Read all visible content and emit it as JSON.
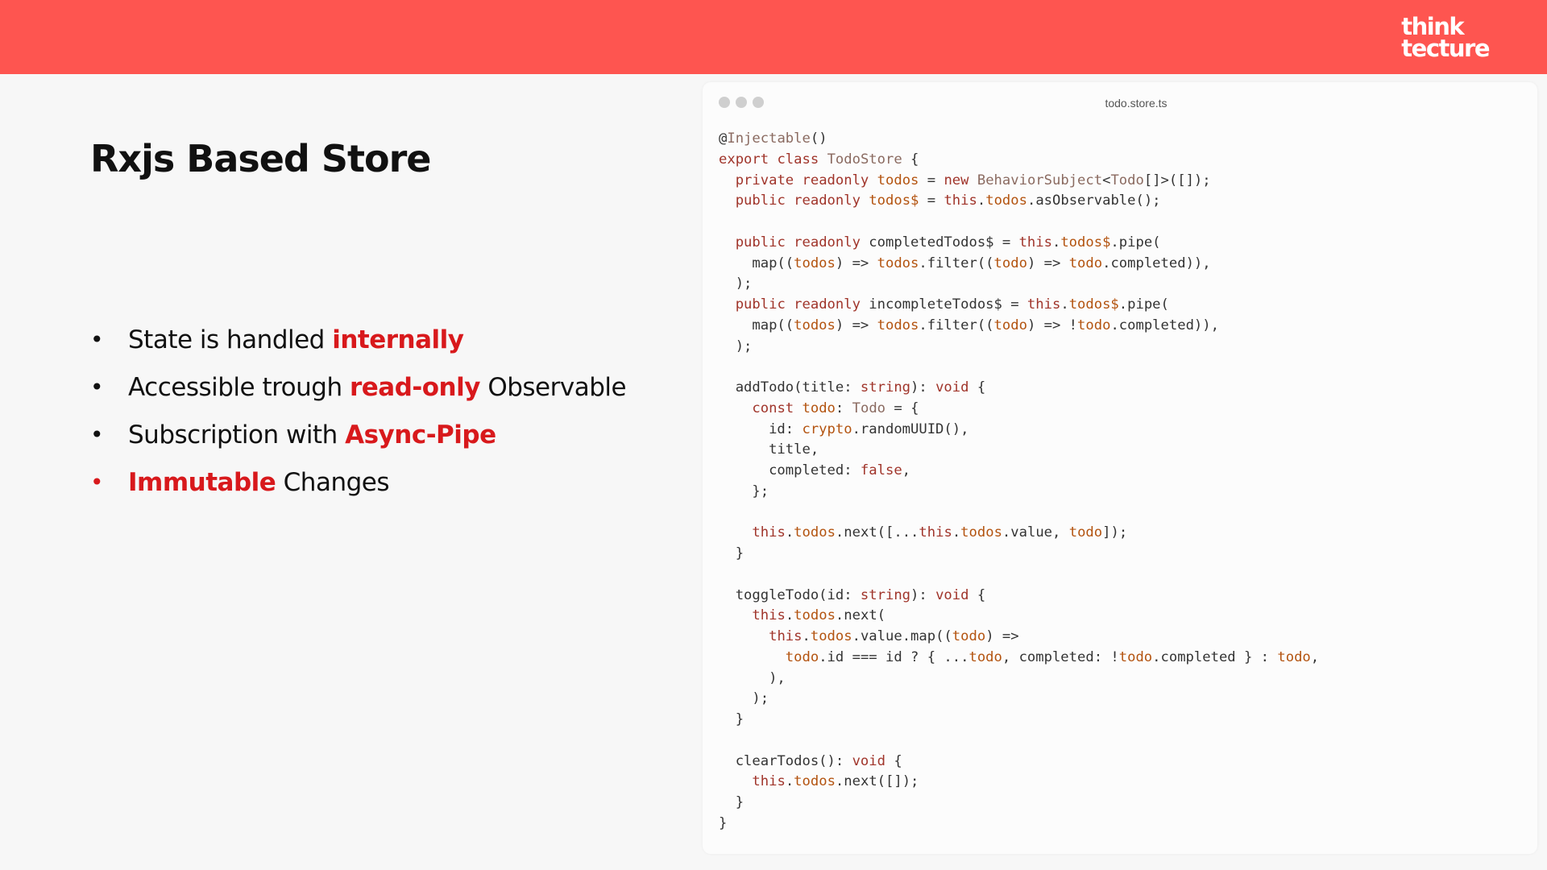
{
  "brand": {
    "line1": "think",
    "line2": "tecture"
  },
  "slide": {
    "title": "Rxjs Based Store",
    "bullets": [
      {
        "before": "State is handled ",
        "highlight": "internally",
        "after": ""
      },
      {
        "before": "Accessible trough ",
        "highlight": "read-only",
        "after": " Observable"
      },
      {
        "before": "Subscription with ",
        "highlight": "Async-Pipe",
        "after": ""
      },
      {
        "before": "",
        "highlight": "Immutable",
        "after": " Changes"
      }
    ],
    "bullet_symbol": "•"
  },
  "code_window": {
    "filename": "todo.store.ts",
    "lines": [
      "@Injectable()",
      "export class TodoStore {",
      "  private readonly todos = new BehaviorSubject<Todo[]>([]);",
      "  public readonly todos$ = this.todos.asObservable();",
      "",
      "  public readonly completedTodos$ = this.todos$.pipe(",
      "    map((todos) => todos.filter((todo) => todo.completed)),",
      "  );",
      "  public readonly incompleteTodos$ = this.todos$.pipe(",
      "    map((todos) => todos.filter((todo) => !todo.completed)),",
      "  );",
      "",
      "  addTodo(title: string): void {",
      "    const todo: Todo = {",
      "      id: crypto.randomUUID(),",
      "      title,",
      "      completed: false,",
      "    };",
      "",
      "    this.todos.next([...this.todos.value, todo]);",
      "  }",
      "",
      "  toggleTodo(id: string): void {",
      "    this.todos.next(",
      "      this.todos.value.map((todo) =>",
      "        todo.id === id ? { ...todo, completed: !todo.completed } : todo,",
      "      ),",
      "    );",
      "  }",
      "",
      "  clearTodos(): void {",
      "    this.todos.next([]);",
      "  }",
      "}"
    ]
  },
  "colors": {
    "header_bar": "#fe5550",
    "highlight": "#d8191c",
    "keyword": "#a0342a",
    "identifier": "#b3530f",
    "type": "#8a6a60"
  }
}
